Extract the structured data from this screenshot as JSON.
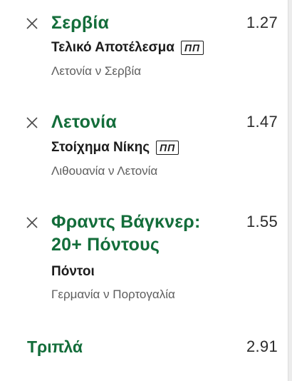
{
  "selections": [
    {
      "name": "Σερβία",
      "odds": "1.27",
      "market": "Τελικό Αποτέλεσμα",
      "badge": "ΠΠ",
      "event": "Λετονία ν Σερβία"
    },
    {
      "name": "Λετονία",
      "odds": "1.47",
      "market": "Στοίχημα Νίκης",
      "badge": "ΠΠ",
      "event": "Λιθουανία ν Λετονία"
    },
    {
      "name": "Φραντς Βάγκνερ: 20+ Πόντους",
      "odds": "1.55",
      "market": "Πόντοι",
      "event": "Γερμανία ν Πορτογαλία"
    }
  ],
  "summary": {
    "label": "Τριπλά",
    "odds": "2.91"
  },
  "icons": {
    "remove": "close-icon"
  },
  "colors": {
    "selection_green": "#136d3a",
    "odds_text": "#2b2b2b",
    "event_text": "#5d5d5d"
  }
}
